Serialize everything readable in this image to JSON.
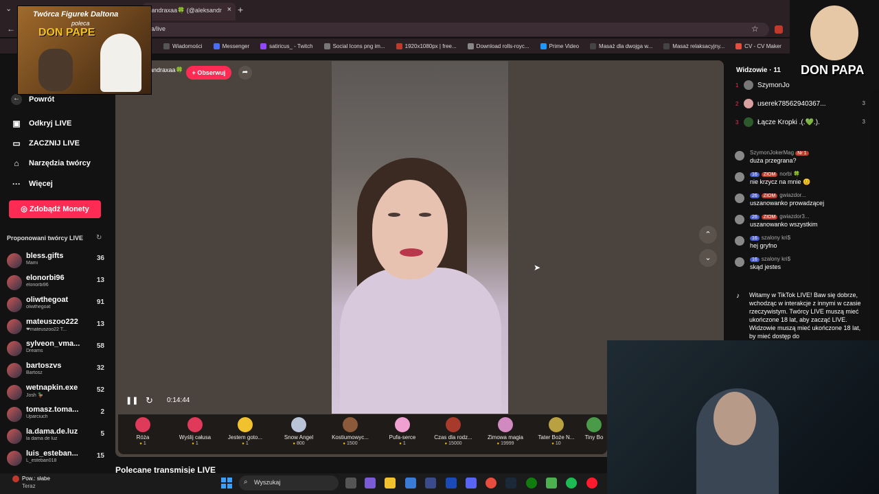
{
  "browser": {
    "tab_title": "sandraxaa🍀 (@aleksandr",
    "url": "a/live",
    "bookmarks": [
      "Wiadomości",
      "Messenger",
      "satiricus_ - Twitch",
      "Social Icons png im...",
      "1920x1080px | free...",
      "Download rolls-royc...",
      "Prime Video",
      "Masaż dla dwojga w...",
      "Masaż relaksacyjny...",
      "CV - CV Maker"
    ],
    "bookmark_prefix": "z"
  },
  "overlay_left": {
    "line1": "Twórca Figurek Daltona",
    "line2": "poleca",
    "line3": "DON PAPE"
  },
  "overlay_right": {
    "brand": "DON PAPA"
  },
  "sidebar": {
    "back": "Powrót",
    "items": [
      {
        "label": "Odkryj LIVE",
        "icon": "live-tv-icon"
      },
      {
        "label": "ZACZNIJ LIVE",
        "icon": "camera-icon"
      },
      {
        "label": "Narzędzia twórcy",
        "icon": "home-icon"
      },
      {
        "label": "Więcej",
        "icon": "more-icon"
      }
    ],
    "coins_button": "Zdobądź Monety",
    "suggested_title": "Proponowani twórcy LIVE",
    "creators": [
      {
        "name": "bless.gifts",
        "sub": "Mami",
        "count": "36"
      },
      {
        "name": "elonorbi96",
        "sub": "elonorbi96",
        "count": "13"
      },
      {
        "name": "oliwthegoat",
        "sub": "oliwthegoat",
        "count": "91"
      },
      {
        "name": "mateuszoo222",
        "sub": "❤mateuszoo22 T...",
        "count": "13"
      },
      {
        "name": "sylveon_vma...",
        "sub": "Dreams",
        "count": "58"
      },
      {
        "name": "bartoszvs",
        "sub": "Bartosz",
        "count": "32"
      },
      {
        "name": "wetnapkin.exe",
        "sub": "Josh 🦆",
        "count": "52"
      },
      {
        "name": "tomasz.toma...",
        "sub": "Uparciuch",
        "count": "2"
      },
      {
        "name": "la.dama.de.luz",
        "sub": "la dama de luz",
        "count": "5"
      },
      {
        "name": "luis_esteban...",
        "sub": "L_esteban018",
        "count": "15"
      }
    ]
  },
  "stream": {
    "host": "andraxaa🍀",
    "follow": "+ Obserwuj",
    "time": "0:14:44",
    "up_arrow": "⌃",
    "down_arrow": "⌄"
  },
  "gifts": [
    {
      "name": "Róża",
      "price": "1",
      "color": "#e03a5a"
    },
    {
      "name": "Wyślij całusa",
      "price": "1",
      "color": "#e03a5a"
    },
    {
      "name": "Jestem goto...",
      "price": "1",
      "color": "#f2c12e"
    },
    {
      "name": "Snow Angel",
      "price": "800",
      "color": "#b9c4d6"
    },
    {
      "name": "Kostiumowyc...",
      "price": "1500",
      "color": "#8a5a3a"
    },
    {
      "name": "Pufa-serce",
      "price": "1",
      "color": "#f0a0d0"
    },
    {
      "name": "Czas dla rodz...",
      "price": "15000",
      "color": "#a83a2b"
    },
    {
      "name": "Zimowa magia",
      "price": "19999",
      "color": "#d08ac0"
    },
    {
      "name": "Tater Boże N...",
      "price": "10",
      "color": "#b9a040"
    },
    {
      "name": "Tiny Bo",
      "price": "",
      "color": "#4a9a4a"
    }
  ],
  "recommended_title": "Polecane transmisje LIVE",
  "chat": {
    "viewers_label": "Widzowie · 11",
    "ranking": [
      {
        "rank": "1",
        "name": "SzymonJo",
        "score": ""
      },
      {
        "rank": "2",
        "name": "userek78562940367...",
        "score": "3"
      },
      {
        "rank": "3",
        "name": "Łącze Kropki .(.💚.).",
        "score": "3"
      }
    ],
    "messages": [
      {
        "user": "SzymonJokerMag",
        "badge": "",
        "tag": "Nr 1",
        "text": "duża przegrana?"
      },
      {
        "user": "norbi 🍀",
        "badge": "16",
        "tag": "ZIOM",
        "text": "nie krzycz na mnie 😊"
      },
      {
        "user": "gwiazdor...",
        "badge": "26",
        "tag": "ZIOM",
        "text": "uszanowanko prowadzącej"
      },
      {
        "user": "gwiazdor3...",
        "badge": "26",
        "tag": "ZIOM",
        "text": "uszanowanko wszystkim"
      },
      {
        "user": "szalony kri$",
        "badge": "16",
        "tag": "",
        "text": "hej gryfno"
      },
      {
        "user": "szalony kri$",
        "badge": "16",
        "tag": "",
        "text": "skąd jestes"
      }
    ],
    "welcome": "Witamy w TikTok LIVE! Baw się dobrze, wchodząc w interakcje z innymi w czasie rzeczywistym. Twórcy LIVE muszą mieć ukończone 18 lat, aby zacząć LIVE. Widzowie muszą mieć ukończone 18 lat, by mieć dostęp do"
  },
  "taskbar": {
    "weather_line1": "Pow.: słabe",
    "weather_line2": "Teraz",
    "search": "Wyszukaj"
  },
  "colors": {
    "accent": "#fe2c55",
    "coin": "#f2b705"
  }
}
